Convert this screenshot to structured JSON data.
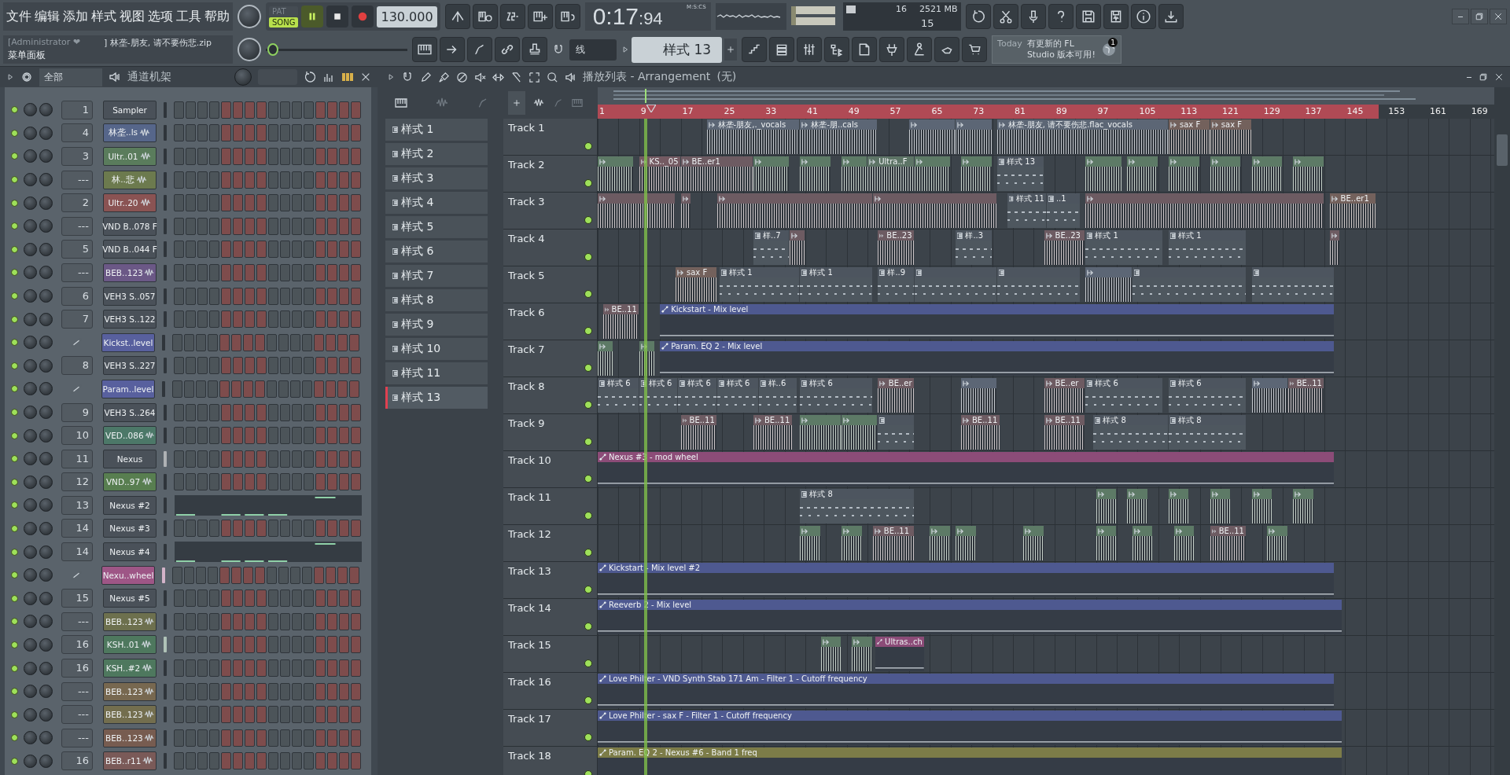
{
  "menu": [
    "文件",
    "编辑",
    "添加",
    "样式",
    "视图",
    "选项",
    "工具",
    "帮助"
  ],
  "hint": {
    "user": "[Administrator ❤",
    "file": "] 林垄-朋友, 请不要伤悲.zip",
    "title": "菜单面板"
  },
  "transport": {
    "modes": [
      {
        "label": "PAT",
        "selected": false
      },
      {
        "label": "SONG",
        "selected": true
      }
    ],
    "tempo": "130.000",
    "pitch": {
      "level": 0.05
    }
  },
  "clock": {
    "time": "0:17",
    "centiseconds": ":94",
    "format": "M:S:CS"
  },
  "monitor": {
    "cpu": "16",
    "memory": "2521 MB",
    "polyphony": "15"
  },
  "snap": "线",
  "pattern_selector": "样式 13",
  "news": {
    "day": "Today",
    "text": "有更新的 FL Studio 版本可用!",
    "badge": "1"
  },
  "channel_rack": {
    "filter": "全部",
    "title": "通道机架",
    "channels": [
      {
        "mixer": "1",
        "kind": "channel",
        "name": "Sampler",
        "color": "#4a5159",
        "audio": false,
        "on": true
      },
      {
        "mixer": "4",
        "kind": "channel",
        "name": "林垄..ls",
        "color": "#56668a",
        "audio": true,
        "on": true
      },
      {
        "mixer": "3",
        "kind": "channel",
        "name": "Ultr..01",
        "color": "#5a7c5c",
        "audio": true,
        "on": true
      },
      {
        "mixer": "---",
        "kind": "channel",
        "name": "林..悲",
        "color": "#6c7a4e",
        "audio": true,
        "on": true
      },
      {
        "mixer": "2",
        "kind": "channel",
        "name": "Ultr..20",
        "color": "#8a5353",
        "audio": true,
        "on": true
      },
      {
        "mixer": "---",
        "kind": "channel",
        "name": "VND B..078 F",
        "color": "#4a5159",
        "audio": false,
        "on": true
      },
      {
        "mixer": "5",
        "kind": "channel",
        "name": "VND B..044 F",
        "color": "#4a5159",
        "audio": false,
        "on": true
      },
      {
        "mixer": "---",
        "kind": "channel",
        "name": "BEB..123",
        "color": "#6b5886",
        "audio": true,
        "on": true
      },
      {
        "mixer": "6",
        "kind": "channel",
        "name": "VEH3 S..057",
        "color": "#4a5159",
        "audio": false,
        "on": true
      },
      {
        "mixer": "7",
        "kind": "channel",
        "name": "VEH3 S..122",
        "color": "#4a5159",
        "audio": false,
        "on": true
      },
      {
        "kind": "automation",
        "name": "Kickst..level",
        "color": "#58609e",
        "audio": false,
        "on": true
      },
      {
        "mixer": "8",
        "kind": "channel",
        "name": "VEH3 S..227",
        "color": "#4a5159",
        "audio": false,
        "on": true
      },
      {
        "kind": "automation",
        "name": "Param..level",
        "color": "#58609e",
        "audio": false,
        "on": true
      },
      {
        "mixer": "9",
        "kind": "channel",
        "name": "VEH3 S..264",
        "color": "#4a5159",
        "audio": false,
        "on": true
      },
      {
        "mixer": "10",
        "kind": "channel",
        "name": "VED..086",
        "color": "#4c7868",
        "audio": true,
        "on": true
      },
      {
        "mixer": "11",
        "kind": "channel",
        "name": "Nexus",
        "color": "#4a5159",
        "audio": false,
        "on": true,
        "meter": true
      },
      {
        "mixer": "12",
        "kind": "channel",
        "name": "VND..97",
        "color": "#587e50",
        "audio": true,
        "on": true
      },
      {
        "mixer": "13",
        "kind": "piano_roll",
        "name": "Nexus #2",
        "color": "#4a5159",
        "audio": false,
        "on": true
      },
      {
        "mixer": "14",
        "kind": "channel",
        "name": "Nexus #3",
        "color": "#4a5159",
        "audio": false,
        "on": true
      },
      {
        "mixer": "14",
        "kind": "piano_roll",
        "name": "Nexus #4",
        "color": "#4a5159",
        "audio": false,
        "on": true
      },
      {
        "kind": "automation",
        "name": "Nexu..wheel",
        "color": "#9e5686",
        "audio": false,
        "on": true,
        "meter": true
      },
      {
        "mixer": "15",
        "kind": "channel",
        "name": "Nexus #5",
        "color": "#4a5159",
        "audio": false,
        "on": true
      },
      {
        "mixer": "---",
        "kind": "channel",
        "name": "BEB..123",
        "color": "#6d704e",
        "audio": true,
        "on": true
      },
      {
        "mixer": "16",
        "kind": "channel",
        "name": "KSH..01",
        "color": "#4e785e",
        "audio": true,
        "on": true,
        "meter": true
      },
      {
        "mixer": "16",
        "kind": "channel",
        "name": "KSH..#2",
        "color": "#4e785e",
        "audio": true,
        "on": true
      },
      {
        "mixer": "---",
        "kind": "channel",
        "name": "BEB..123",
        "color": "#776850",
        "audio": true,
        "on": true
      },
      {
        "mixer": "---",
        "kind": "channel",
        "name": "BEB..123",
        "color": "#736e4e",
        "audio": true,
        "on": true
      },
      {
        "mixer": "---",
        "kind": "channel",
        "name": "BEB..123",
        "color": "#775c50",
        "audio": true,
        "on": true
      },
      {
        "mixer": "16",
        "kind": "channel",
        "name": "BEB..r11",
        "color": "#7a5a58",
        "audio": true,
        "on": true
      }
    ]
  },
  "playlist": {
    "title": "播放列表 - Arrangement",
    "arrangement": "(无)",
    "patterns": [
      {
        "label": "样式 1",
        "selected": false
      },
      {
        "label": "样式 2",
        "selected": false
      },
      {
        "label": "样式 3",
        "selected": false
      },
      {
        "label": "样式 4",
        "selected": false
      },
      {
        "label": "样式 5",
        "selected": false
      },
      {
        "label": "样式 6",
        "selected": false
      },
      {
        "label": "样式 7",
        "selected": false
      },
      {
        "label": "样式 8",
        "selected": false
      },
      {
        "label": "样式 9",
        "selected": false
      },
      {
        "label": "样式 10",
        "selected": false
      },
      {
        "label": "样式 11",
        "selected": false
      },
      {
        "label": "样式 13",
        "selected": true
      }
    ],
    "ruler": [
      "1",
      "9",
      "17",
      "25",
      "33",
      "41",
      "49",
      "57",
      "65",
      "73",
      "81",
      "89",
      "97",
      "105",
      "113",
      "121",
      "129",
      "137",
      "145",
      "153",
      "161",
      "169"
    ],
    "tracks": [
      {
        "name": "Track 1",
        "clips": [
          {
            "kind": "audio",
            "label": "林垄-朋友,._vocals",
            "color": "#5c6675"
          },
          {
            "kind": "audio",
            "label": "林垄-朋..cals",
            "color": "#5c6675"
          },
          {
            "kind": "audio",
            "color": "#5c6675"
          },
          {
            "kind": "audio",
            "color": "#5c6675"
          },
          {
            "kind": "audio",
            "label": "林垄-朋友, 请不要伤悲.flac_vocals",
            "color": "#5c6675"
          },
          {
            "kind": "audio",
            "label": "sax F",
            "color": "#73615c"
          },
          {
            "kind": "audio",
            "label": "sax F",
            "color": "#73615c"
          }
        ]
      },
      {
        "name": "Track 2",
        "clips": [
          {
            "kind": "audio",
            "color": "#5d7a66"
          },
          {
            "kind": "audio",
            "label": "KS.._05",
            "color": "#745a62"
          },
          {
            "kind": "audio",
            "label": "BE..er1",
            "color": "#6d5b62"
          },
          {
            "kind": "audio",
            "color": "#5d7a66"
          },
          {
            "kind": "audio",
            "color": "#5d7a66"
          },
          {
            "kind": "audio",
            "color": "#5d7a66"
          },
          {
            "kind": "audio",
            "label": "Ultra..F",
            "color": "#5d7466"
          },
          {
            "kind": "audio",
            "color": "#5d7a66"
          },
          {
            "kind": "audio",
            "color": "#5d7a66"
          },
          {
            "kind": "pattern",
            "label": "样式 13",
            "color": "#4d555f"
          },
          {
            "kind": "audio",
            "color": "#5d7a66"
          },
          {
            "kind": "audio",
            "color": "#5d7a66"
          },
          {
            "kind": "audio",
            "color": "#5d7a66"
          },
          {
            "kind": "audio",
            "color": "#5d7a66"
          },
          {
            "kind": "audio",
            "color": "#5d7a66"
          },
          {
            "kind": "audio",
            "color": "#5d7a66"
          }
        ]
      },
      {
        "name": "Track 3",
        "clips": [
          {
            "kind": "audio",
            "color": "#6d5b62"
          },
          {
            "kind": "audio",
            "color": "#6d5b62"
          },
          {
            "kind": "audio",
            "color": "#6d5b62"
          },
          {
            "kind": "audio",
            "color": "#6d5b62"
          },
          {
            "kind": "pattern",
            "label": "样式 11",
            "color": "#4d555f"
          },
          {
            "kind": "pattern",
            "label": "..1",
            "color": "#4d555f"
          },
          {
            "kind": "audio",
            "color": "#6d5b62"
          },
          {
            "kind": "audio",
            "label": "BE..er1",
            "color": "#73615c"
          }
        ]
      },
      {
        "name": "Track 4",
        "clips": [
          {
            "kind": "pattern",
            "label": "样..7",
            "color": "#4d555f"
          },
          {
            "kind": "audio",
            "color": "#6d5b62"
          },
          {
            "kind": "audio",
            "label": "BE..23",
            "color": "#6d5b62"
          },
          {
            "kind": "pattern",
            "label": "样..3",
            "color": "#4d555f"
          },
          {
            "kind": "audio",
            "label": "BE..23",
            "color": "#6d5b62"
          },
          {
            "kind": "pattern",
            "label": "样式 1",
            "color": "#4d555f"
          },
          {
            "kind": "pattern",
            "label": "样式 1",
            "color": "#4d555f"
          },
          {
            "kind": "audio",
            "color": "#6d5b62"
          }
        ]
      },
      {
        "name": "Track 5",
        "clips": [
          {
            "kind": "audio",
            "label": "sax F",
            "color": "#73615c"
          },
          {
            "kind": "pattern",
            "label": "样式 1",
            "color": "#4d555f"
          },
          {
            "kind": "pattern",
            "label": "样式 1",
            "color": "#4d555f"
          },
          {
            "kind": "pattern",
            "label": "样..9",
            "color": "#4d555f"
          },
          {
            "kind": "pattern",
            "color": "#4d555f"
          },
          {
            "kind": "pattern",
            "color": "#4d555f"
          },
          {
            "kind": "audio",
            "color": "#5c6675"
          },
          {
            "kind": "pattern",
            "color": "#4d555f"
          },
          {
            "kind": "pattern",
            "color": "#4d555f"
          }
        ]
      },
      {
        "name": "Track 6",
        "clips": [
          {
            "kind": "audio",
            "label": "BE..11",
            "color": "#6d5b62"
          },
          {
            "kind": "automation",
            "label": "Kickstart - Mix level",
            "color": "#4e5990"
          }
        ]
      },
      {
        "name": "Track 7",
        "clips": [
          {
            "kind": "audio",
            "color": "#5d7a66"
          },
          {
            "kind": "audio",
            "color": "#5d7a66"
          },
          {
            "kind": "automation",
            "label": "Param. EQ 2 - Mix level",
            "color": "#4e5990"
          }
        ]
      },
      {
        "name": "Track 8",
        "clips": [
          {
            "kind": "pattern",
            "label": "样式 6",
            "color": "#4d555f"
          },
          {
            "kind": "pattern",
            "label": "样式 6",
            "color": "#4d555f"
          },
          {
            "kind": "pattern",
            "label": "样式 6",
            "color": "#4d555f"
          },
          {
            "kind": "pattern",
            "label": "样式 6",
            "color": "#4d555f"
          },
          {
            "kind": "pattern",
            "label": "样..6",
            "color": "#4d555f"
          },
          {
            "kind": "pattern",
            "label": "样式 6",
            "color": "#4d555f"
          },
          {
            "kind": "audio",
            "label": "BE..er",
            "color": "#6d5b62"
          },
          {
            "kind": "audio",
            "color": "#5c6675"
          },
          {
            "kind": "audio",
            "label": "BE..er",
            "color": "#6d5b62"
          },
          {
            "kind": "pattern",
            "label": "样式 6",
            "color": "#4d555f"
          },
          {
            "kind": "pattern",
            "label": "样式 6",
            "color": "#4d555f"
          },
          {
            "kind": "audio",
            "color": "#5c6675"
          },
          {
            "kind": "audio",
            "label": "BE..11",
            "color": "#6d5b62"
          }
        ]
      },
      {
        "name": "Track 9",
        "clips": [
          {
            "kind": "audio",
            "label": "BE..11",
            "color": "#6d5b62"
          },
          {
            "kind": "audio",
            "label": "BE..11",
            "color": "#6d5b62"
          },
          {
            "kind": "audio",
            "color": "#5d7a66"
          },
          {
            "kind": "audio",
            "color": "#5d7a66"
          },
          {
            "kind": "pattern",
            "color": "#4d555f"
          },
          {
            "kind": "audio",
            "label": "BE..11",
            "color": "#6d5b62"
          },
          {
            "kind": "audio",
            "label": "BE..11",
            "color": "#6d5b62"
          },
          {
            "kind": "pattern",
            "label": "样式 8",
            "color": "#4d555f"
          },
          {
            "kind": "pattern",
            "label": "样式 8",
            "color": "#4d555f"
          }
        ]
      },
      {
        "name": "Track 10",
        "clips": [
          {
            "kind": "automation",
            "label": "Nexus #3 - mod wheel",
            "color": "#8c4c78"
          }
        ]
      },
      {
        "name": "Track 11",
        "clips": [
          {
            "kind": "pattern",
            "label": "样式 8",
            "color": "#4d555f"
          },
          {
            "kind": "audio",
            "color": "#5d7a66"
          },
          {
            "kind": "audio",
            "color": "#5d7a66"
          },
          {
            "kind": "audio",
            "color": "#5d7a66"
          },
          {
            "kind": "audio",
            "color": "#5d7a66"
          },
          {
            "kind": "audio",
            "color": "#5d7a66"
          },
          {
            "kind": "audio",
            "color": "#5d7a66"
          }
        ]
      },
      {
        "name": "Track 12",
        "clips": [
          {
            "kind": "audio",
            "color": "#5d7a66"
          },
          {
            "kind": "audio",
            "color": "#5d7a66"
          },
          {
            "kind": "audio",
            "label": "BE..11",
            "color": "#6d5b62"
          },
          {
            "kind": "audio",
            "color": "#5d7a66"
          },
          {
            "kind": "audio",
            "color": "#5d7a66"
          },
          {
            "kind": "audio",
            "color": "#5d7a66"
          },
          {
            "kind": "audio",
            "color": "#5d7a66"
          },
          {
            "kind": "audio",
            "color": "#5d7a66"
          },
          {
            "kind": "audio",
            "color": "#5d7a66"
          },
          {
            "kind": "audio",
            "label": "BE..11",
            "color": "#6d5b62"
          },
          {
            "kind": "audio",
            "color": "#5d7a66"
          }
        ]
      },
      {
        "name": "Track 13",
        "clips": [
          {
            "kind": "automation",
            "label": "Kickstart - Mix level #2",
            "color": "#4e5990"
          }
        ]
      },
      {
        "name": "Track 14",
        "clips": [
          {
            "kind": "automation",
            "label": "Reeverb 2 - Mix level",
            "color": "#4e5990"
          }
        ]
      },
      {
        "name": "Track 15",
        "clips": [
          {
            "kind": "audio",
            "color": "#5d7a66"
          },
          {
            "kind": "audio",
            "color": "#5d7a66"
          },
          {
            "kind": "automation",
            "label": "Ultras..ch",
            "color": "#8c4c78"
          }
        ]
      },
      {
        "name": "Track 16",
        "clips": [
          {
            "kind": "automation",
            "label": "Love Philter - VND Synth Stab 171 Am - Filter 1 - Cutoff frequency",
            "color": "#4e5990"
          }
        ]
      },
      {
        "name": "Track 17",
        "clips": [
          {
            "kind": "automation",
            "label": "Love Philter - sax F - Filter 1 - Cutoff frequency",
            "color": "#4e5990"
          }
        ]
      },
      {
        "name": "Track 18",
        "clips": [
          {
            "kind": "automation",
            "label": "Param. EQ 2 - Nexus #6 - Band 1 freq",
            "color": "#7c7c48"
          }
        ]
      }
    ]
  }
}
